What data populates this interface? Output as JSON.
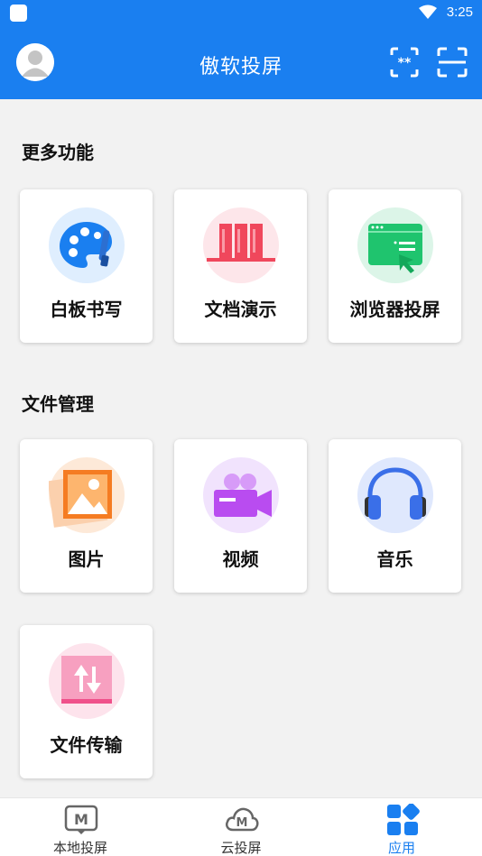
{
  "status_bar": {
    "time": "3:25"
  },
  "header": {
    "title": "傲软投屏"
  },
  "sections": [
    {
      "title": "更多功能",
      "items": [
        {
          "label": "白板书写",
          "icon": "palette-icon",
          "color": "#1a7ff0"
        },
        {
          "label": "文档演示",
          "icon": "books-icon",
          "color": "#f0475c"
        },
        {
          "label": "浏览器投屏",
          "icon": "browser-icon",
          "color": "#1fc46e"
        }
      ]
    },
    {
      "title": "文件管理",
      "items": [
        {
          "label": "图片",
          "icon": "image-icon",
          "color": "#f57c22"
        },
        {
          "label": "视频",
          "icon": "video-camera-icon",
          "color": "#b94cf0"
        },
        {
          "label": "音乐",
          "icon": "headphones-icon",
          "color": "#3a6fe8"
        },
        {
          "label": "文件传输",
          "icon": "file-transfer-icon",
          "color": "#f0508a"
        }
      ]
    }
  ],
  "bottom_nav": [
    {
      "label": "本地投屏",
      "icon": "local-cast-icon",
      "active": false
    },
    {
      "label": "云投屏",
      "icon": "cloud-cast-icon",
      "active": false
    },
    {
      "label": "应用",
      "icon": "apps-grid-icon",
      "active": true
    }
  ],
  "colors": {
    "primary": "#1a7ff0",
    "background": "#f2f2f2"
  }
}
